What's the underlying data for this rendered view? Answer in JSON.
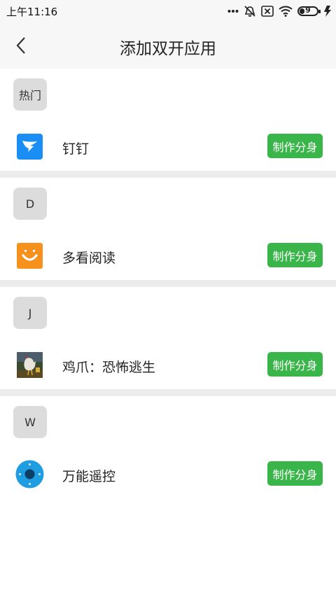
{
  "status_bar": {
    "time": "上午11:16",
    "battery_level": "9"
  },
  "header": {
    "title": "添加双开应用"
  },
  "sections": [
    {
      "letter": "热门",
      "app_name": "钉钉",
      "button_label": "制作分身",
      "icon": "dingtalk-icon"
    },
    {
      "letter": "D",
      "app_name": "多看阅读",
      "button_label": "制作分身",
      "icon": "duokan-icon"
    },
    {
      "letter": "J",
      "app_name": "鸡爪：恐怖逃生",
      "button_label": "制作分身",
      "icon": "chicken-claw-game-icon"
    },
    {
      "letter": "W",
      "app_name": "万能遥控",
      "button_label": "制作分身",
      "icon": "remote-control-icon"
    }
  ],
  "colors": {
    "accent_button": "#3ab54a",
    "header_background": "#f7f7f7",
    "separator": "#ececec"
  }
}
